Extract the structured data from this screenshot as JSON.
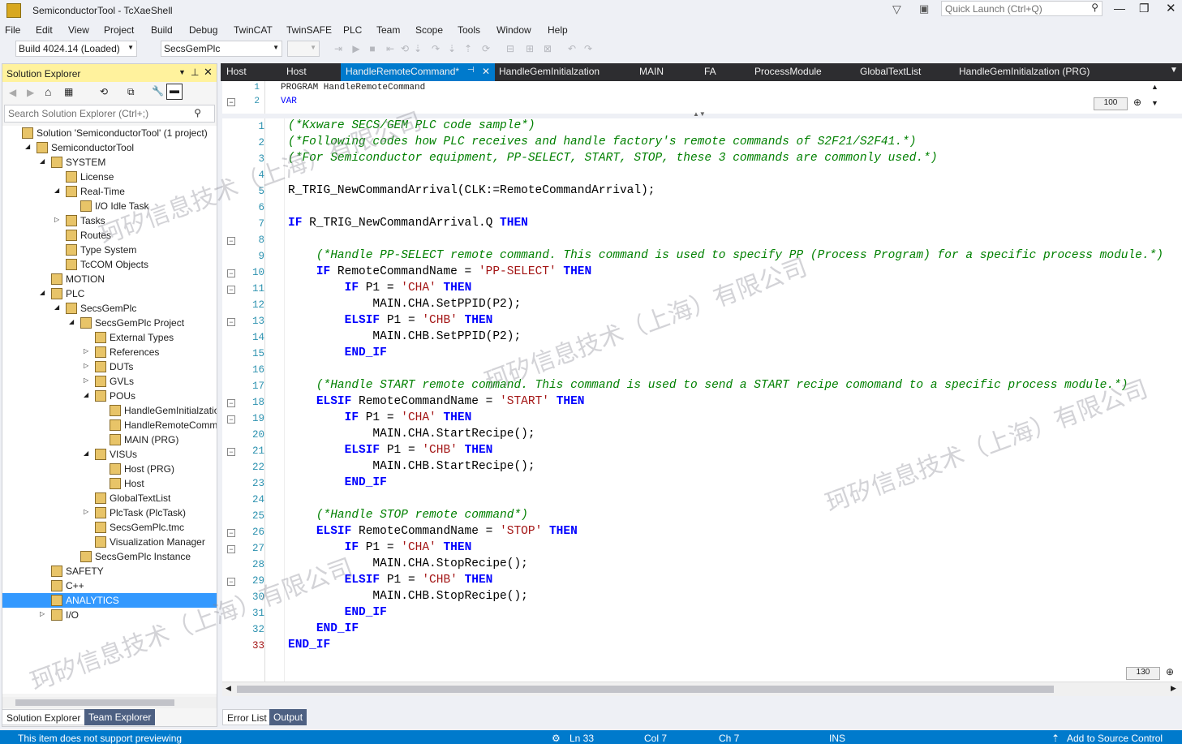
{
  "window": {
    "title": "SemiconductorTool - TcXaeShell",
    "quick_launch_placeholder": "Quick Launch (Ctrl+Q)"
  },
  "menu": [
    "File",
    "Edit",
    "View",
    "Project",
    "Build",
    "Debug",
    "TwinCAT",
    "TwinSAFE",
    "PLC",
    "Team",
    "Scope",
    "Tools",
    "Window",
    "Help"
  ],
  "toolbar": {
    "build_select": "Build 4024.14 (Loaded)",
    "project_select": "SecsGemPlc"
  },
  "solution_explorer": {
    "title": "Solution Explorer",
    "search_placeholder": "Search Solution Explorer (Ctrl+;)",
    "tree": [
      {
        "label": "Solution 'SemiconductorTool' (1 project)",
        "indent": 0,
        "exp": ""
      },
      {
        "label": "SemiconductorTool",
        "indent": 1,
        "exp": "◢"
      },
      {
        "label": "SYSTEM",
        "indent": 2,
        "exp": "◢"
      },
      {
        "label": "License",
        "indent": 3,
        "exp": ""
      },
      {
        "label": "Real-Time",
        "indent": 3,
        "exp": "◢"
      },
      {
        "label": "I/O Idle Task",
        "indent": 4,
        "exp": ""
      },
      {
        "label": "Tasks",
        "indent": 3,
        "exp": "▷"
      },
      {
        "label": "Routes",
        "indent": 3,
        "exp": ""
      },
      {
        "label": "Type System",
        "indent": 3,
        "exp": ""
      },
      {
        "label": "TcCOM Objects",
        "indent": 3,
        "exp": ""
      },
      {
        "label": "MOTION",
        "indent": 2,
        "exp": ""
      },
      {
        "label": "PLC",
        "indent": 2,
        "exp": "◢"
      },
      {
        "label": "SecsGemPlc",
        "indent": 3,
        "exp": "◢"
      },
      {
        "label": "SecsGemPlc Project",
        "indent": 4,
        "exp": "◢"
      },
      {
        "label": "External Types",
        "indent": 5,
        "exp": ""
      },
      {
        "label": "References",
        "indent": 5,
        "exp": "▷"
      },
      {
        "label": "DUTs",
        "indent": 5,
        "exp": "▷"
      },
      {
        "label": "GVLs",
        "indent": 5,
        "exp": "▷"
      },
      {
        "label": "POUs",
        "indent": 5,
        "exp": "◢"
      },
      {
        "label": "HandleGemInitialzation",
        "indent": 6,
        "exp": ""
      },
      {
        "label": "HandleRemoteComma",
        "indent": 6,
        "exp": ""
      },
      {
        "label": "MAIN (PRG)",
        "indent": 6,
        "exp": ""
      },
      {
        "label": "VISUs",
        "indent": 5,
        "exp": "◢"
      },
      {
        "label": "Host (PRG)",
        "indent": 6,
        "exp": ""
      },
      {
        "label": "Host",
        "indent": 6,
        "exp": ""
      },
      {
        "label": "GlobalTextList",
        "indent": 5,
        "exp": ""
      },
      {
        "label": "PlcTask (PlcTask)",
        "indent": 5,
        "exp": "▷"
      },
      {
        "label": "SecsGemPlc.tmc",
        "indent": 5,
        "exp": ""
      },
      {
        "label": "Visualization Manager",
        "indent": 5,
        "exp": ""
      },
      {
        "label": "SecsGemPlc Instance",
        "indent": 4,
        "exp": ""
      },
      {
        "label": "SAFETY",
        "indent": 2,
        "exp": ""
      },
      {
        "label": "C++",
        "indent": 2,
        "exp": ""
      },
      {
        "label": "ANALYTICS",
        "indent": 2,
        "exp": "",
        "selected": true
      },
      {
        "label": "I/O",
        "indent": 2,
        "exp": "▷"
      }
    ],
    "bottom_tabs": [
      "Solution Explorer",
      "Team Explorer"
    ]
  },
  "doc_tabs": [
    "Host",
    "Host",
    "HandleRemoteCommand*",
    "HandleGemInitialzation",
    "MAIN",
    "FA",
    "ProcessModule",
    "GlobalTextList",
    "HandleGemInitialzation (PRG)"
  ],
  "declaration": {
    "lines": [
      "PROGRAM HandleRemoteCommand",
      "VAR"
    ],
    "zoom": "100"
  },
  "code_lines": [
    [
      [
        "cm",
        "(*Kxware SECS/GEM PLC code sample*)"
      ]
    ],
    [
      [
        "cm",
        "(*Following codes how PLC receives and handle factory's remote commands of S2F21/S2F41.*)"
      ]
    ],
    [
      [
        "cm",
        "(*For Semiconductor equipment, PP-SELECT, START, STOP, these 3 commands are commonly used.*)"
      ]
    ],
    [],
    [
      [
        "tx",
        "R_TRIG_NewCommandArrival(CLK:=RemoteCommandArrival);"
      ]
    ],
    [],
    [
      [
        "kw",
        "IF"
      ],
      [
        "tx",
        " R_TRIG_NewCommandArrival.Q "
      ],
      [
        "kw",
        "THEN"
      ]
    ],
    [],
    [
      [
        "tx",
        "    "
      ],
      [
        "cm",
        "(*Handle PP-SELECT remote command. This command is used to specify PP (Process Program) for a specific process module.*)"
      ]
    ],
    [
      [
        "tx",
        "    "
      ],
      [
        "kw",
        "IF"
      ],
      [
        "tx",
        " RemoteCommandName = "
      ],
      [
        "st",
        "'PP-SELECT'"
      ],
      [
        "tx",
        " "
      ],
      [
        "kw",
        "THEN"
      ]
    ],
    [
      [
        "tx",
        "        "
      ],
      [
        "kw",
        "IF"
      ],
      [
        "tx",
        " P1 = "
      ],
      [
        "st",
        "'CHA'"
      ],
      [
        "tx",
        " "
      ],
      [
        "kw",
        "THEN"
      ]
    ],
    [
      [
        "tx",
        "            MAIN.CHA.SetPPID(P2);"
      ]
    ],
    [
      [
        "tx",
        "        "
      ],
      [
        "kw",
        "ELSIF"
      ],
      [
        "tx",
        " P1 = "
      ],
      [
        "st",
        "'CHB'"
      ],
      [
        "tx",
        " "
      ],
      [
        "kw",
        "THEN"
      ]
    ],
    [
      [
        "tx",
        "            MAIN.CHB.SetPPID(P2);"
      ]
    ],
    [
      [
        "tx",
        "        "
      ],
      [
        "kw",
        "END_IF"
      ]
    ],
    [],
    [
      [
        "tx",
        "    "
      ],
      [
        "cm",
        "(*Handle START remote command. This command is used to send a START recipe comomand to a specific process module.*)"
      ]
    ],
    [
      [
        "tx",
        "    "
      ],
      [
        "kw",
        "ELSIF"
      ],
      [
        "tx",
        " RemoteCommandName = "
      ],
      [
        "st",
        "'START'"
      ],
      [
        "tx",
        " "
      ],
      [
        "kw",
        "THEN"
      ]
    ],
    [
      [
        "tx",
        "        "
      ],
      [
        "kw",
        "IF"
      ],
      [
        "tx",
        " P1 = "
      ],
      [
        "st",
        "'CHA'"
      ],
      [
        "tx",
        " "
      ],
      [
        "kw",
        "THEN"
      ]
    ],
    [
      [
        "tx",
        "            MAIN.CHA.StartRecipe();"
      ]
    ],
    [
      [
        "tx",
        "        "
      ],
      [
        "kw",
        "ELSIF"
      ],
      [
        "tx",
        " P1 = "
      ],
      [
        "st",
        "'CHB'"
      ],
      [
        "tx",
        " "
      ],
      [
        "kw",
        "THEN"
      ]
    ],
    [
      [
        "tx",
        "            MAIN.CHB.StartRecipe();"
      ]
    ],
    [
      [
        "tx",
        "        "
      ],
      [
        "kw",
        "END_IF"
      ]
    ],
    [],
    [
      [
        "tx",
        "    "
      ],
      [
        "cm",
        "(*Handle STOP remote command*)"
      ]
    ],
    [
      [
        "tx",
        "    "
      ],
      [
        "kw",
        "ELSIF"
      ],
      [
        "tx",
        " RemoteCommandName = "
      ],
      [
        "st",
        "'STOP'"
      ],
      [
        "tx",
        " "
      ],
      [
        "kw",
        "THEN"
      ]
    ],
    [
      [
        "tx",
        "        "
      ],
      [
        "kw",
        "IF"
      ],
      [
        "tx",
        " P1 = "
      ],
      [
        "st",
        "'CHA'"
      ],
      [
        "tx",
        " "
      ],
      [
        "kw",
        "THEN"
      ]
    ],
    [
      [
        "tx",
        "            MAIN.CHA.StopRecipe();"
      ]
    ],
    [
      [
        "tx",
        "        "
      ],
      [
        "kw",
        "ELSIF"
      ],
      [
        "tx",
        " P1 = "
      ],
      [
        "st",
        "'CHB'"
      ],
      [
        "tx",
        " "
      ],
      [
        "kw",
        "THEN"
      ]
    ],
    [
      [
        "tx",
        "            MAIN.CHB.StopRecipe();"
      ]
    ],
    [
      [
        "tx",
        "        "
      ],
      [
        "kw",
        "END_IF"
      ]
    ],
    [
      [
        "tx",
        "    "
      ],
      [
        "kw",
        "END_IF"
      ]
    ],
    [
      [
        "kw",
        "END_IF"
      ]
    ]
  ],
  "fold_lines": [
    8,
    10,
    11,
    13,
    18,
    19,
    21,
    26,
    27,
    29
  ],
  "editor_zoom": "130",
  "bottom_tabs": [
    "Error List",
    "Output"
  ],
  "status": {
    "message": "This item does not support previewing",
    "ln": "Ln 33",
    "col": "Col 7",
    "ch": "Ch 7",
    "mode": "INS",
    "source_control": "Add to Source Control"
  },
  "watermarks": [
    "珂矽信息技术（上海）有限公司",
    "珂矽信息技术（上海）有限公司",
    "珂矽信息技术（上海）有限公司",
    "珂矽信息技术（上海）有限公司"
  ]
}
